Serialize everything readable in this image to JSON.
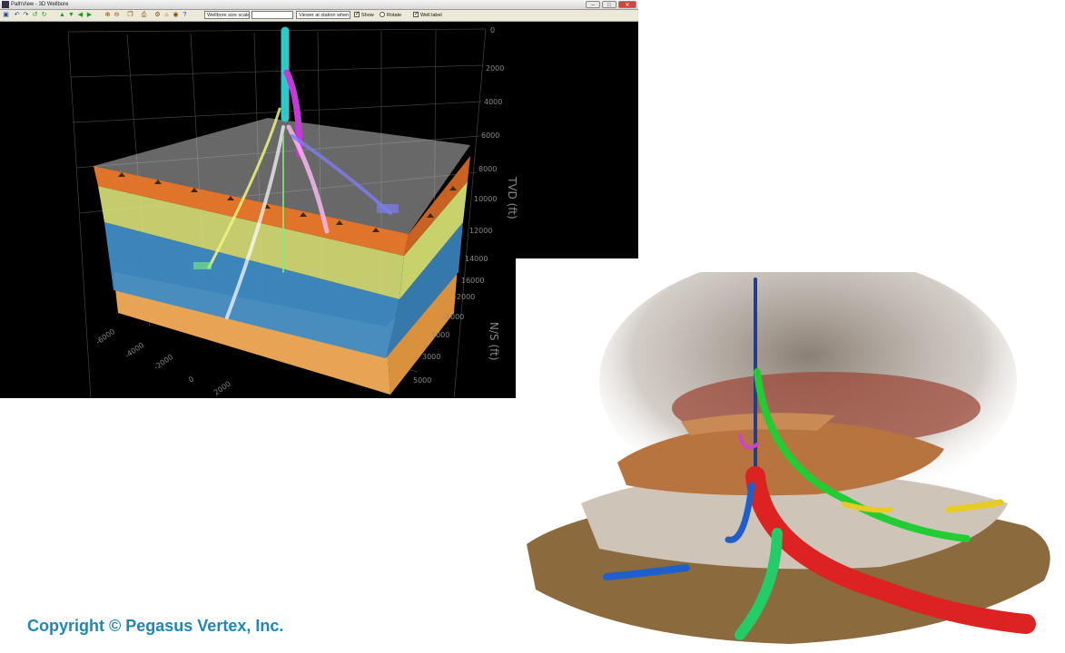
{
  "window": {
    "title": "PathView - 3D Wellbore",
    "minimize_label": "–",
    "maximize_label": "□",
    "close_label": "✕"
  },
  "toolbar": {
    "view_mode_value": "Wellbore size scale",
    "scale_value": "",
    "display_value": "Viewer at station when",
    "show_label": "Show",
    "rotate_label": "Rotate",
    "well_label_label": "Well label",
    "show_checked": true,
    "rotate_checked": false,
    "well_label_checked": true
  },
  "axes": {
    "tvd_label": "TVD (ft)",
    "ns_label": "N/S (ft)",
    "tvd_ticks": [
      "0",
      "2000",
      "4000",
      "6000",
      "8000",
      "10000",
      "12000",
      "14000",
      "16000"
    ],
    "ns_ticks": [
      "-2000",
      "-1000",
      "1000",
      "3000",
      "5000"
    ],
    "ew_ticks": [
      "-6000",
      "-4000",
      "-2000",
      "0",
      "2000"
    ]
  },
  "colors": {
    "shale_band": "#e0742a",
    "sand_layer": "#d9e27a",
    "limestone_layer": "#3f8cc4",
    "bottom_layer": "#e7a455",
    "wellbores": [
      "#2bc9c9",
      "#c838d8",
      "#f4f47a",
      "#ffffff",
      "#f7b7f0",
      "#7d7df0",
      "#7cf07c"
    ],
    "illustration_wells": [
      "#1f3f8a",
      "#22cc33",
      "#dd2222",
      "#1e5fcc",
      "#e6cc22",
      "#cc44cc",
      "#22cc66"
    ]
  },
  "copyright": "Copyright © Pegasus Vertex, Inc."
}
